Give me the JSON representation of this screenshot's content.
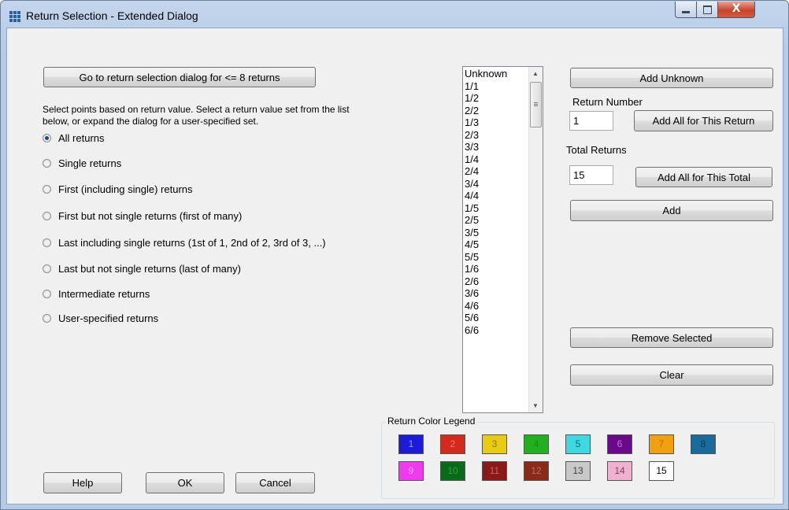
{
  "window": {
    "title": "Return Selection - Extended Dialog",
    "icon": "grid-app-icon",
    "close_glyph": "X"
  },
  "left": {
    "go_button": "Go to return selection dialog for <= 8 returns",
    "description_line1": "Select points based on return value.  Select a return value set from the list",
    "description_line2": "below, or expand the dialog for a user-specified set.",
    "radios": [
      {
        "label": "All returns",
        "selected": true
      },
      {
        "label": "Single returns",
        "selected": false
      },
      {
        "label": "First (including single) returns",
        "selected": false
      },
      {
        "label": "First but not single returns (first of many)",
        "selected": false
      },
      {
        "label": "Last including single returns (1st of 1, 2nd of 2, 3rd of 3, ...)",
        "selected": false
      },
      {
        "label": "Last but not single returns (last of many)",
        "selected": false
      },
      {
        "label": "Intermediate returns",
        "selected": false
      },
      {
        "label": "User-specified returns",
        "selected": false
      }
    ]
  },
  "list": {
    "items": [
      "Unknown",
      "1/1",
      "1/2",
      "2/2",
      "1/3",
      "2/3",
      "3/3",
      "1/4",
      "2/4",
      "3/4",
      "4/4",
      "1/5",
      "2/5",
      "3/5",
      "4/5",
      "5/5",
      "1/6",
      "2/6",
      "3/6",
      "4/6",
      "5/6",
      "6/6"
    ]
  },
  "right": {
    "add_unknown": "Add Unknown",
    "return_number_label": "Return Number",
    "return_number_value": "1",
    "add_all_return": "Add All for This Return",
    "total_returns_label": "Total Returns",
    "total_returns_value": "15",
    "add_all_total": "Add All for This Total",
    "add": "Add",
    "remove_selected": "Remove Selected",
    "clear": "Clear"
  },
  "legend": {
    "title": "Return Color Legend",
    "swatches": [
      {
        "label": "1",
        "bg": "#1c1cd8",
        "fg": "#8fa0ff"
      },
      {
        "label": "2",
        "bg": "#d42a1e",
        "fg": "#f07a6a"
      },
      {
        "label": "3",
        "bg": "#e8cc14",
        "fg": "#8a7a10"
      },
      {
        "label": "4",
        "bg": "#22b022",
        "fg": "#1a8a1a"
      },
      {
        "label": "5",
        "bg": "#3ed8e0",
        "fg": "#1a6a8a"
      },
      {
        "label": "6",
        "bg": "#6a0a8a",
        "fg": "#c07ad0"
      },
      {
        "label": "7",
        "bg": "#f0a010",
        "fg": "#c06a00"
      },
      {
        "label": "8",
        "bg": "#1a6a9a",
        "fg": "#0a3a6a"
      },
      {
        "label": "9",
        "bg": "#f03af0",
        "fg": "#f0a0f0"
      },
      {
        "label": "10",
        "bg": "#0a6a1a",
        "fg": "#3a9a3a"
      },
      {
        "label": "11",
        "bg": "#8a1a1a",
        "fg": "#d06060"
      },
      {
        "label": "12",
        "bg": "#8a2a1a",
        "fg": "#c06a5a"
      },
      {
        "label": "13",
        "bg": "#c8c8c8",
        "fg": "#404040"
      },
      {
        "label": "14",
        "bg": "#f0b0d0",
        "fg": "#6a4a5a"
      },
      {
        "label": "15",
        "bg": "#ffffff",
        "fg": "#000000"
      }
    ]
  },
  "footer": {
    "help": "Help",
    "ok": "OK",
    "cancel": "Cancel"
  }
}
